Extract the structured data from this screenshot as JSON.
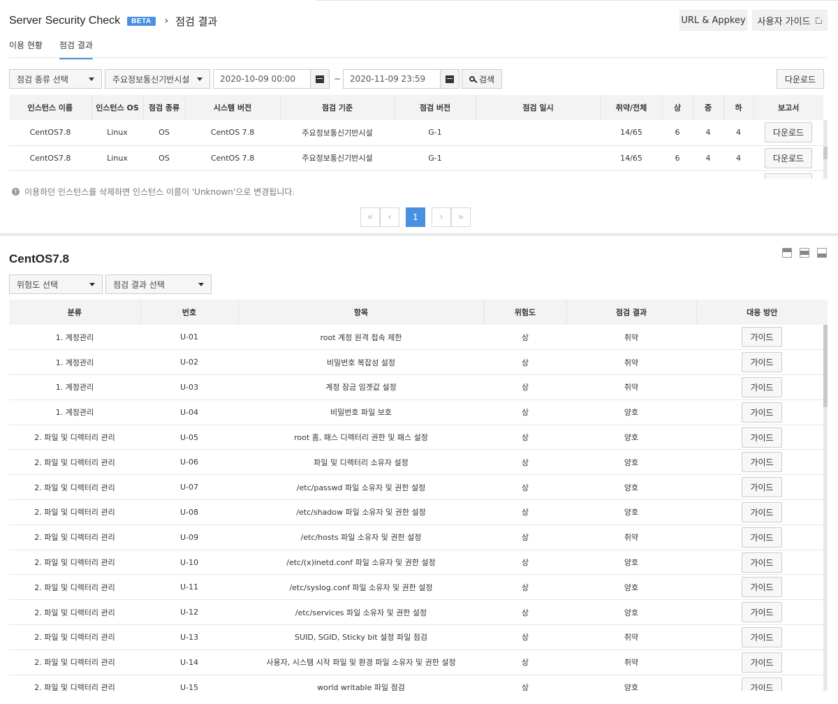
{
  "header": {
    "app_title": "Server Security Check",
    "beta": "BETA",
    "separator": "›",
    "page_title": "점검 결과",
    "btn_url": "URL & Appkey",
    "btn_guide": "사용자 가이드"
  },
  "tabs": [
    {
      "label": "이용 현황",
      "active": false
    },
    {
      "label": "점검 결과",
      "active": true
    }
  ],
  "filters": {
    "check_type": "점검 종류 선택",
    "standard": "주요정보통신기반시설",
    "date_from": "2020-10-09 00:00",
    "tilde": "~",
    "date_to": "2020-11-09 23:59",
    "search": "검색",
    "download": "다운로드"
  },
  "instance_table": {
    "columns": [
      "인스턴스 이름",
      "인스턴스 OS",
      "점검 종류",
      "시스템 버전",
      "점검 기준",
      "점검 버전",
      "점검 일시",
      "취약/전체",
      "상",
      "중",
      "하",
      "보고서"
    ],
    "rows": [
      {
        "name": "CentOS7.8",
        "os": "Linux",
        "type": "OS",
        "sysver": "CentOS 7.8",
        "standard": "주요정보통신기반시설",
        "ver": "G-1",
        "date": "",
        "ratio": "14/65",
        "high": "6",
        "mid": "4",
        "low": "4",
        "report": "다운로드"
      },
      {
        "name": "CentOS7.8",
        "os": "Linux",
        "type": "OS",
        "sysver": "CentOS 7.8",
        "standard": "주요정보통신기반시설",
        "ver": "G-1",
        "date": "",
        "ratio": "14/65",
        "high": "6",
        "mid": "4",
        "low": "4",
        "report": "다운로드"
      }
    ]
  },
  "notice": "이용하던 인스턴스를 삭제하면 인스턴스 이름이 'Unknown'으로 변경됩니다.",
  "pagination": {
    "first": "«",
    "prev": "‹",
    "current": "1",
    "next": "›",
    "last": "»"
  },
  "detail": {
    "title": "CentOS7.8",
    "risk_select": "위험도 선택",
    "result_select": "점검 결과 선택"
  },
  "result_table": {
    "columns": [
      "분류",
      "번호",
      "항목",
      "위험도",
      "점검 결과",
      "대응 방안"
    ],
    "rows": [
      {
        "cat": "1. 계정관리",
        "no": "U-01",
        "item": "root 계정 원격 접속 제한",
        "risk": "상",
        "result": "취약",
        "action": "가이드"
      },
      {
        "cat": "1. 계정관리",
        "no": "U-02",
        "item": "비밀번호 복잡성 설정",
        "risk": "상",
        "result": "취약",
        "action": "가이드"
      },
      {
        "cat": "1. 계정관리",
        "no": "U-03",
        "item": "계정 잠금 임곗값 설정",
        "risk": "상",
        "result": "취약",
        "action": "가이드"
      },
      {
        "cat": "1. 계정관리",
        "no": "U-04",
        "item": "비밀번호 파일 보호",
        "risk": "상",
        "result": "양호",
        "action": "가이드"
      },
      {
        "cat": "2. 파일 및 디렉터리 관리",
        "no": "U-05",
        "item": "root 홈, 패스 디렉터리 권한 및 패스 설정",
        "risk": "상",
        "result": "양호",
        "action": "가이드"
      },
      {
        "cat": "2. 파일 및 디렉터리 관리",
        "no": "U-06",
        "item": "파일 및 디렉터리 소유자 설정",
        "risk": "상",
        "result": "양호",
        "action": "가이드"
      },
      {
        "cat": "2. 파일 및 디렉터리 관리",
        "no": "U-07",
        "item": "/etc/passwd 파일 소유자 및 권한 설정",
        "risk": "상",
        "result": "양호",
        "action": "가이드"
      },
      {
        "cat": "2. 파일 및 디렉터리 관리",
        "no": "U-08",
        "item": "/etc/shadow 파일 소유자 및 권한 설정",
        "risk": "상",
        "result": "양호",
        "action": "가이드"
      },
      {
        "cat": "2. 파일 및 디렉터리 관리",
        "no": "U-09",
        "item": "/etc/hosts 파일 소유자 및 권한 설정",
        "risk": "상",
        "result": "취약",
        "action": "가이드"
      },
      {
        "cat": "2. 파일 및 디렉터리 관리",
        "no": "U-10",
        "item": "/etc/(x)inetd.conf 파일 소유자 및 권한 설정",
        "risk": "상",
        "result": "양호",
        "action": "가이드"
      },
      {
        "cat": "2. 파일 및 디렉터리 관리",
        "no": "U-11",
        "item": "/etc/syslog.conf 파일 소유자 및 권한 설정",
        "risk": "상",
        "result": "양호",
        "action": "가이드"
      },
      {
        "cat": "2. 파일 및 디렉터리 관리",
        "no": "U-12",
        "item": "/etc/services 파일 소유자 및 권한 설정",
        "risk": "상",
        "result": "양호",
        "action": "가이드"
      },
      {
        "cat": "2. 파일 및 디렉터리 관리",
        "no": "U-13",
        "item": "SUID, SGID, Sticky bit 설정 파일 점검",
        "risk": "상",
        "result": "취약",
        "action": "가이드"
      },
      {
        "cat": "2. 파일 및 디렉터리 관리",
        "no": "U-14",
        "item": "사용자, 시스템 시작 파일 및 환경 파일 소유자 및 권한 설정",
        "risk": "상",
        "result": "취약",
        "action": "가이드"
      },
      {
        "cat": "2. 파일 및 디렉터리 관리",
        "no": "U-15",
        "item": "world writable 파일 점검",
        "risk": "상",
        "result": "양호",
        "action": "가이드"
      }
    ]
  },
  "colors": {
    "accent": "#4a90e2",
    "header_bg": "#f3f3f3",
    "border": "#cccccc"
  }
}
